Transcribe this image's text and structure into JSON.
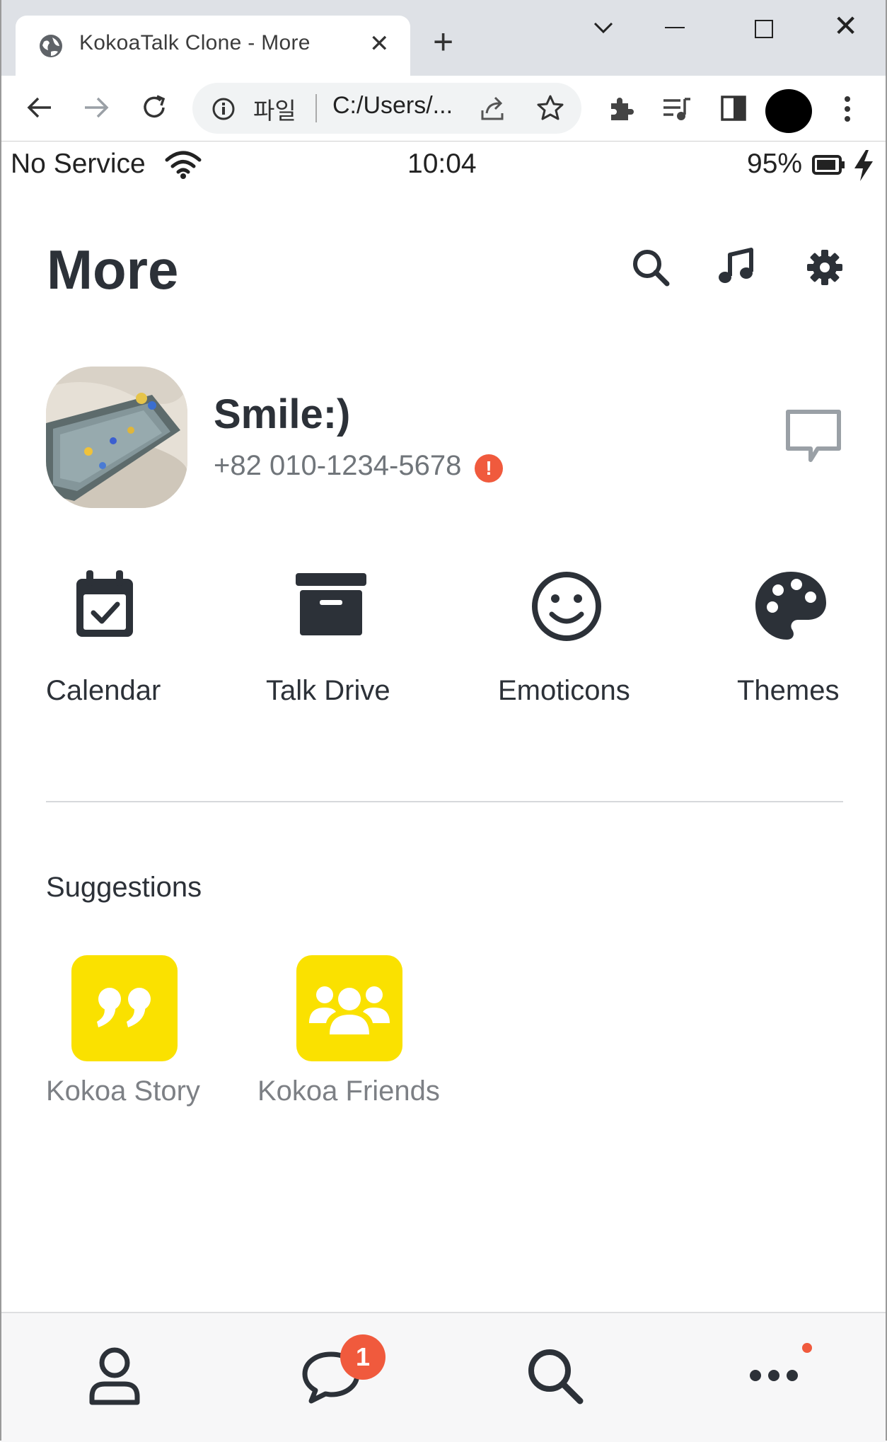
{
  "browser": {
    "tab_title": "KokoaTalk Clone - More",
    "close_glyph": "✕",
    "new_tab_glyph": "+",
    "window_close_glyph": "✕",
    "address_prefix": "파일",
    "address_url": "C:/Users/..."
  },
  "status_bar": {
    "carrier": "No Service",
    "time": "10:04",
    "battery": "95%"
  },
  "header": {
    "title": "More",
    "icons": [
      "search-icon",
      "music-note-icon",
      "gear-icon"
    ]
  },
  "profile": {
    "name": "Smile:)",
    "phone": "+82 010-1234-5678",
    "alert_glyph": "!"
  },
  "menu": {
    "items": [
      {
        "label": "Calendar",
        "icon": "calendar-check-icon"
      },
      {
        "label": "Talk Drive",
        "icon": "archive-box-icon"
      },
      {
        "label": "Emoticons",
        "icon": "smiley-face-icon"
      },
      {
        "label": "Themes",
        "icon": "palette-icon"
      }
    ]
  },
  "suggestions": {
    "title": "Suggestions",
    "items": [
      {
        "label": "Kokoa Story",
        "icon": "quote-icon"
      },
      {
        "label": "Kokoa Friends",
        "icon": "users-icon"
      }
    ]
  },
  "tabbar": {
    "items": [
      "person-icon",
      "chat-bubble-icon",
      "search-icon",
      "ellipsis-icon"
    ],
    "chat_badge": "1"
  },
  "colors": {
    "accent_yellow": "#fae100",
    "alert_red": "#f05a3d",
    "text_dark": "#2c3138",
    "text_muted": "#70757a"
  }
}
